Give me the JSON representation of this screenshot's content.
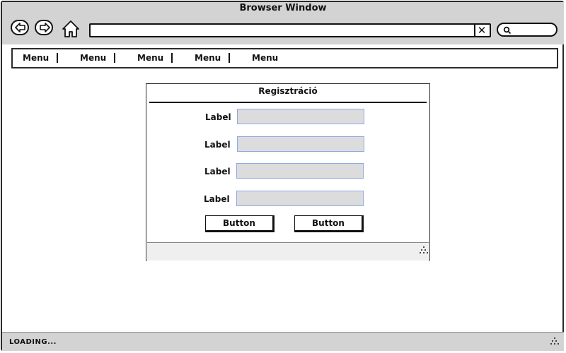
{
  "window": {
    "title": "Browser Window",
    "url_value": "",
    "search_value": "",
    "status": "LOADING..."
  },
  "menubar": {
    "items": [
      "Menu",
      "Menu",
      "Menu",
      "Menu",
      "Menu"
    ]
  },
  "dialog": {
    "title": "Regisztráció",
    "fields": [
      {
        "label": "Label",
        "value": ""
      },
      {
        "label": "Label",
        "value": ""
      },
      {
        "label": "Label",
        "value": ""
      },
      {
        "label": "Label",
        "value": ""
      }
    ],
    "buttons": [
      "Button",
      "Button"
    ]
  },
  "icons": {
    "back": "back-arrow-icon",
    "forward": "forward-arrow-icon",
    "home": "home-icon",
    "clear": "close-icon",
    "search": "search-icon",
    "resize": "resize-grip-icon"
  },
  "colors": {
    "chrome": "#d3d3d3",
    "field_fill": "#dcdcdc",
    "field_border": "#8ea9e8",
    "outline": "#111111"
  }
}
